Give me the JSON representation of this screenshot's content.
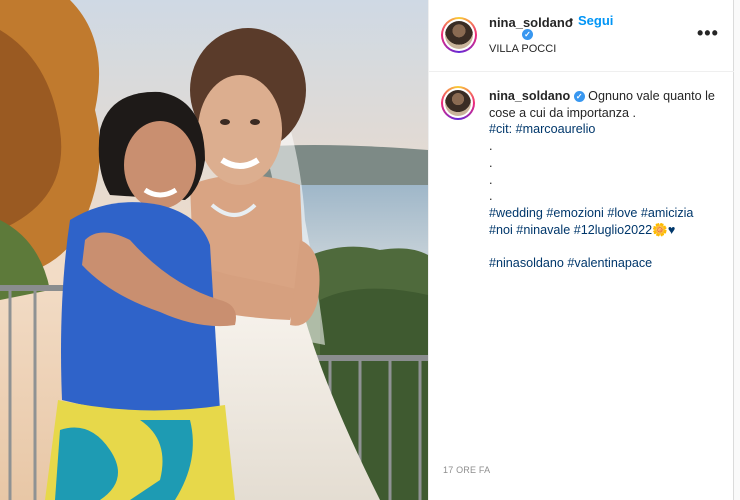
{
  "header": {
    "username": "nina_soldano",
    "verified_icon": "verified-badge-icon",
    "separator": "•",
    "follow_label": "Segui",
    "location": "VILLA POCCI",
    "more_icon": "more-options-icon",
    "more_glyph": "•••"
  },
  "caption": {
    "username": "nina_soldano",
    "text": "Ognuno vale quanto le cose a cui da importanza .",
    "lines": [
      "#cit: #marcoaurelio",
      ".",
      ".",
      ".",
      ".",
      "#wedding #emozioni #love #amicizia",
      "#noi #ninavale #12luglio2022🌼♥",
      "",
      "#ninasoldano #valentinapace"
    ]
  },
  "timestamp": "17 ORE FA",
  "colors": {
    "link": "#0095f6",
    "hashtag": "#00376b",
    "verified": "#3897f0",
    "muted": "#8e8e8e"
  }
}
